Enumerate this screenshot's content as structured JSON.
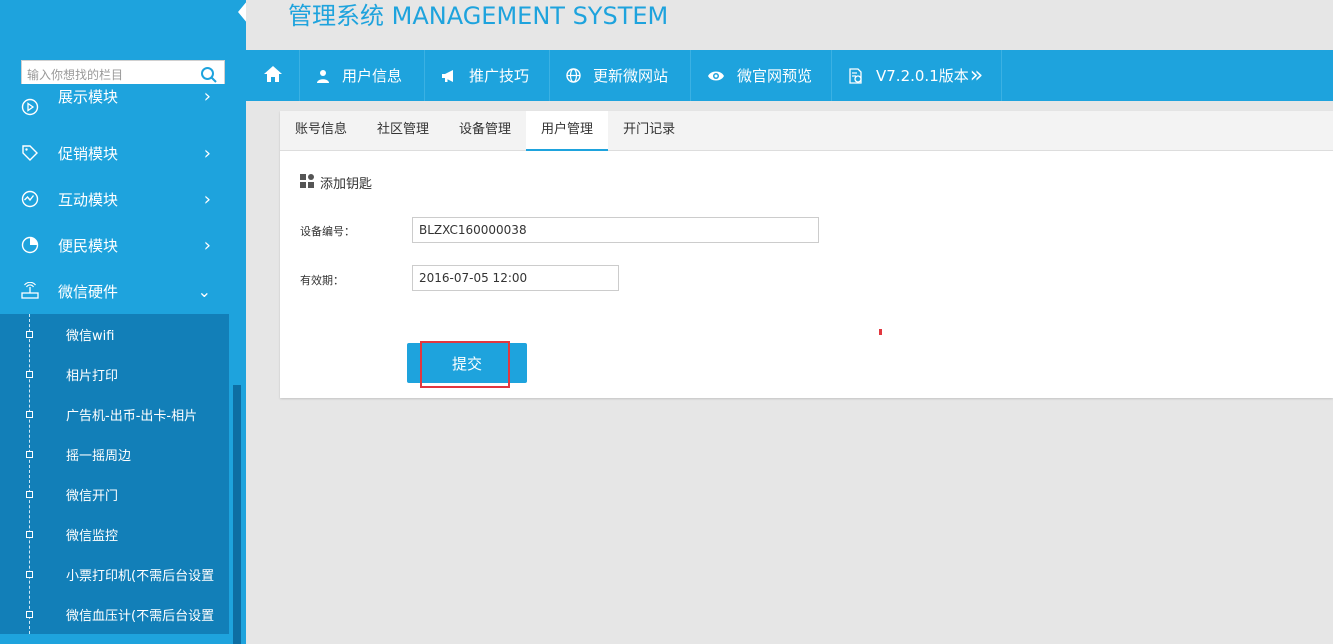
{
  "header": {
    "title": "管理系统 MANAGEMENT SYSTEM"
  },
  "sidebar": {
    "search_placeholder": "输入你想找的栏目",
    "items": [
      {
        "label": "展示模块",
        "icon": "play-circle-icon",
        "arrow": "›"
      },
      {
        "label": "促销模块",
        "icon": "tag-icon",
        "arrow": "›"
      },
      {
        "label": "互动模块",
        "icon": "activity-icon",
        "arrow": "›"
      },
      {
        "label": "便民模块",
        "icon": "pie-chart-icon",
        "arrow": "›"
      },
      {
        "label": "微信硬件",
        "icon": "router-icon",
        "arrow": "⌄"
      }
    ],
    "subitems": [
      {
        "label": "微信wifi"
      },
      {
        "label": "相片打印"
      },
      {
        "label": "广告机-出币-出卡-相片"
      },
      {
        "label": "摇一摇周边"
      },
      {
        "label": "微信开门"
      },
      {
        "label": "微信监控"
      },
      {
        "label": "小票打印机(不需后台设置"
      },
      {
        "label": "微信血压计(不需后台设置"
      }
    ]
  },
  "topnav": {
    "items": [
      {
        "label": "用户信息",
        "icon": "user-icon"
      },
      {
        "label": "推广技巧",
        "icon": "megaphone-icon"
      },
      {
        "label": "更新微网站",
        "icon": "globe-icon"
      },
      {
        "label": "微官网预览",
        "icon": "eye-icon"
      },
      {
        "label": "V7.2.0.1版本",
        "icon": "document-settings-icon",
        "suffix": "»"
      }
    ]
  },
  "panel": {
    "tabs": [
      {
        "label": "账号信息",
        "active": false
      },
      {
        "label": "社区管理",
        "active": false
      },
      {
        "label": "设备管理",
        "active": false
      },
      {
        "label": "用户管理",
        "active": true
      },
      {
        "label": "开门记录",
        "active": false
      }
    ],
    "section_title": "添加钥匙",
    "fields": {
      "device_label": "设备编号：",
      "device_value": "BLZXC160000038",
      "expiry_label": "有效期：",
      "expiry_value": "2016-07-05 12:00"
    },
    "submit_label": "提交"
  },
  "colors": {
    "primary": "#1ea3dd",
    "submenu": "#127fb8",
    "highlight": "#e2373f"
  }
}
